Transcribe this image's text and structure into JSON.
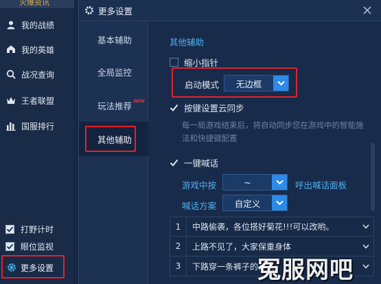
{
  "app_sidebar": {
    "top_label": "火爆资讯",
    "items": [
      {
        "label": "我的战绩",
        "icon": "person-icon"
      },
      {
        "label": "我的英雄",
        "icon": "helmet-icon"
      },
      {
        "label": "战况查询",
        "icon": "search-icon"
      },
      {
        "label": "王者联盟",
        "icon": "crown-icon"
      },
      {
        "label": "国服排行",
        "icon": "bar-chart-icon"
      }
    ],
    "checks": [
      {
        "label": "打野计时",
        "checked": true
      },
      {
        "label": "眼位监视",
        "checked": true
      }
    ],
    "more_settings": "更多设置"
  },
  "dialog": {
    "title": "更多设置",
    "nav": [
      {
        "label": "基本辅助",
        "active": false
      },
      {
        "label": "全局监控",
        "active": false
      },
      {
        "label": "玩法推荐",
        "active": false,
        "badge": "NEW"
      },
      {
        "label": "其他辅助",
        "active": true
      }
    ],
    "content": {
      "section_title": "其他辅助",
      "shrink_pointer": {
        "label": "缩小指针",
        "checked": false
      },
      "launch_mode": {
        "label": "启动模式",
        "value": "无边框"
      },
      "cloud_sync": {
        "label": "按键设置云同步",
        "checked": true
      },
      "cloud_sync_desc": "每一局游戏结束后，将自动同步您在游戏中的智能施法和快捷键配置",
      "one_key_shout": {
        "label": "一键喊话",
        "checked": true
      },
      "in_game_press": {
        "label": "游戏中按",
        "value": "~",
        "suffix": "呼出喊话面板"
      },
      "shout_scheme": {
        "label": "喊话方案",
        "value": "自定义"
      },
      "shout_list": [
        {
          "num": "1",
          "text": "中路偷袭，各位搭好菊花!!!可以改哟。"
        },
        {
          "num": "2",
          "text": "上路不见了，大家保重身体"
        },
        {
          "num": "3",
          "text": "下路穿一条裤子的基友"
        }
      ]
    }
  },
  "watermark": "冤服网吧",
  "colors": {
    "accent_blue": "#4fb0ee",
    "highlight_red": "#e0242b",
    "button_blue": "#2d8ae6"
  }
}
